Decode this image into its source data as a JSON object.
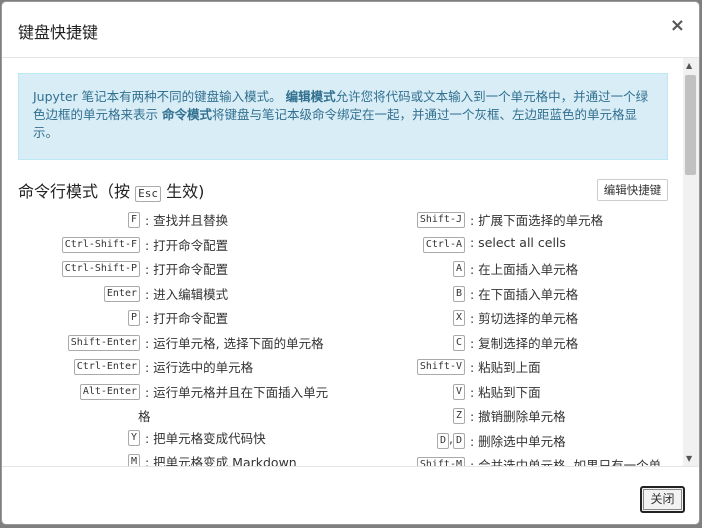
{
  "dialog": {
    "title": "键盘快捷键",
    "close_icon": "×",
    "close_button": "关闭"
  },
  "info": {
    "p1": "Jupyter 笔记本有两种不同的键盘输入模式。",
    "edit_mode": "编辑模式",
    "p2": "允许您将代码或文本输入到一个单元格中，并通过一个绿色边框的单元格来表示",
    "command_mode": "命令模式",
    "p3": "将键盘与笔记本级命令绑定在一起，并通过一个灰框、左边距蓝色的单元格显示。"
  },
  "section": {
    "title_pre": "命令行模式（按",
    "key": "Esc",
    "title_post": "生效)",
    "edit_shortcuts": "编辑快捷键"
  },
  "left": [
    {
      "keys": "F",
      "desc": ": 查找并且替换"
    },
    {
      "keys": "Ctrl-Shift-F",
      "desc": ": 打开命令配置"
    },
    {
      "keys": "Ctrl-Shift-P",
      "desc": ": 打开命令配置"
    },
    {
      "keys": "Enter",
      "desc": ": 进入编辑模式"
    },
    {
      "keys": "P",
      "desc": ": 打开命令配置"
    },
    {
      "keys": "Shift-Enter",
      "desc": ": 运行单元格, 选择下面的单元格"
    },
    {
      "keys": "Ctrl-Enter",
      "desc": ": 运行选中的单元格"
    },
    {
      "keys": "Alt-Enter",
      "desc": ": 运行单元格并且在下面插入单元",
      "desc2": "格"
    },
    {
      "keys": "Y",
      "desc": ": 把单元格变成代码快"
    },
    {
      "keys": "M",
      "desc": ": 把单元格变成 Markdown"
    }
  ],
  "right": [
    {
      "keys": "Shift-J",
      "desc": ": 扩展下面选择的单元格"
    },
    {
      "keys": "Ctrl-A",
      "desc": ": select all cells"
    },
    {
      "keys": "A",
      "desc": ": 在上面插入单元格"
    },
    {
      "keys": "B",
      "desc": ": 在下面插入单元格"
    },
    {
      "keys": "X",
      "desc": ": 剪切选择的单元格"
    },
    {
      "keys": "C",
      "desc": ": 复制选择的单元格"
    },
    {
      "keys": "Shift-V",
      "desc": ": 粘贴到上面"
    },
    {
      "keys": "V",
      "desc": ": 粘贴到下面"
    },
    {
      "keys": "Z",
      "desc": ": 撤销删除单元格"
    },
    {
      "keys": "D,D",
      "desc": ": 删除选中单元格"
    },
    {
      "keys": "Shift-M",
      "desc": ": 合并选中单元格, 如果只有一个单"
    }
  ]
}
